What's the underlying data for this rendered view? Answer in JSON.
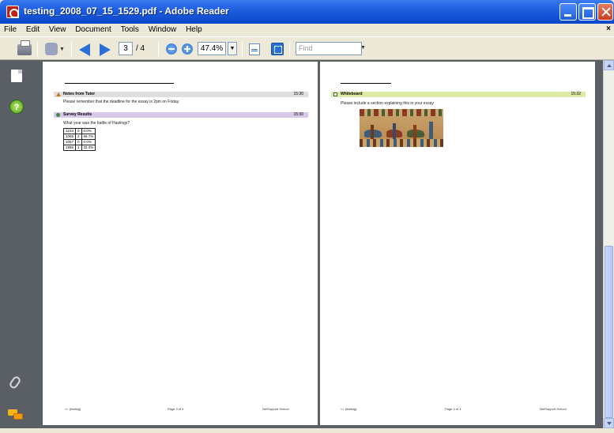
{
  "window": {
    "title": "testing_2008_07_15_1529.pdf - Adobe Reader"
  },
  "menu": {
    "items": [
      "File",
      "Edit",
      "View",
      "Document",
      "Tools",
      "Window",
      "Help"
    ],
    "close_glyph": "×"
  },
  "toolbar": {
    "current_page": "3",
    "page_total": "/ 4",
    "zoom": "47.4%",
    "find_placeholder": "Find"
  },
  "icons": {
    "nav_pages": "pages-icon",
    "nav_help": "help-icon",
    "nav_attach": "paperclip-icon",
    "nav_comments": "comments-icon",
    "help_glyph": "?"
  },
  "colors": {
    "notes_bar": "#dedede",
    "survey_bar": "#d8c8ea",
    "whiteboard_bar": "#dbeaa4",
    "panel": "#5a5f66"
  },
  "page_left": {
    "notes": {
      "title": "Notes from Tutor",
      "time": "15:30",
      "body": "Please remember that the deadline for the essay is 2pm on Friday."
    },
    "survey": {
      "title": "Survey Results",
      "time": "15:30",
      "question": "What year was the battle of Hastings?",
      "rows": [
        [
          "1234",
          "0",
          "0.0%"
        ],
        [
          "1066",
          "2",
          "66.7%"
        ],
        [
          "1067",
          "0",
          "0.0%"
        ],
        [
          "1956",
          "1",
          "33.3%"
        ]
      ]
    },
    "footer": {
      "left": "<< (testing)",
      "center": "Page 3 of 4",
      "right": "NetSupport School"
    }
  },
  "page_right": {
    "whiteboard": {
      "title": "Whiteboard",
      "time": "15:32",
      "body": "Please include a section explaining this in your essay"
    },
    "footer": {
      "left": "<< (testing)",
      "center": "Page 4 of 4",
      "right": "NetSupport School"
    }
  }
}
